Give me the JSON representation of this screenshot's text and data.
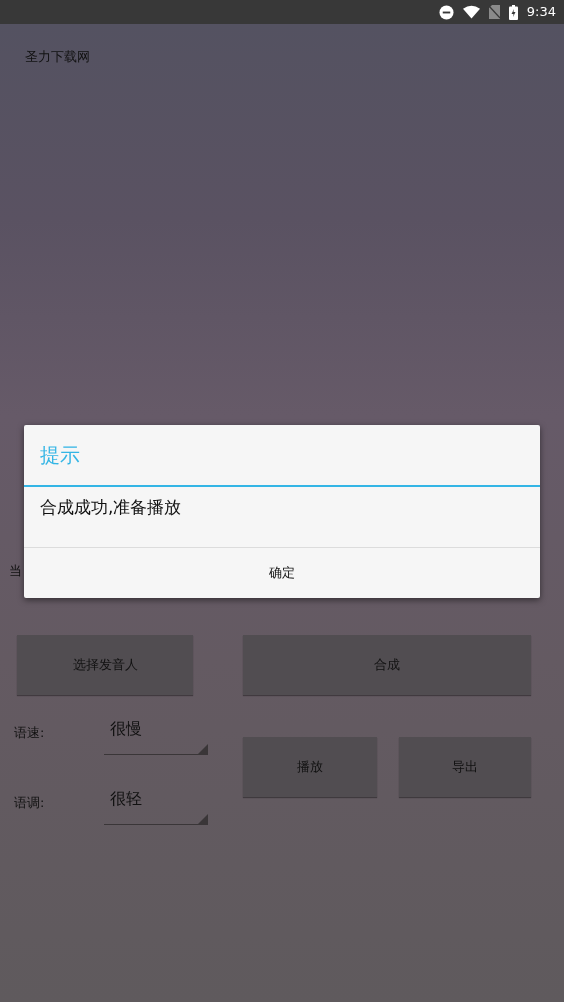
{
  "status_bar": {
    "time": "9:34"
  },
  "app": {
    "title": "圣力下载网",
    "cut_label": "当",
    "voice_button": "选择发音人",
    "synth_button": "合成",
    "settings": [
      {
        "label": "语速:",
        "value": "很慢"
      },
      {
        "label": "语调:",
        "value": "很轻"
      }
    ],
    "play_button": "播放",
    "export_button": "导出"
  },
  "dialog": {
    "title": "提示",
    "message": "合成成功,准备播放",
    "buttons": [
      "确定"
    ]
  }
}
